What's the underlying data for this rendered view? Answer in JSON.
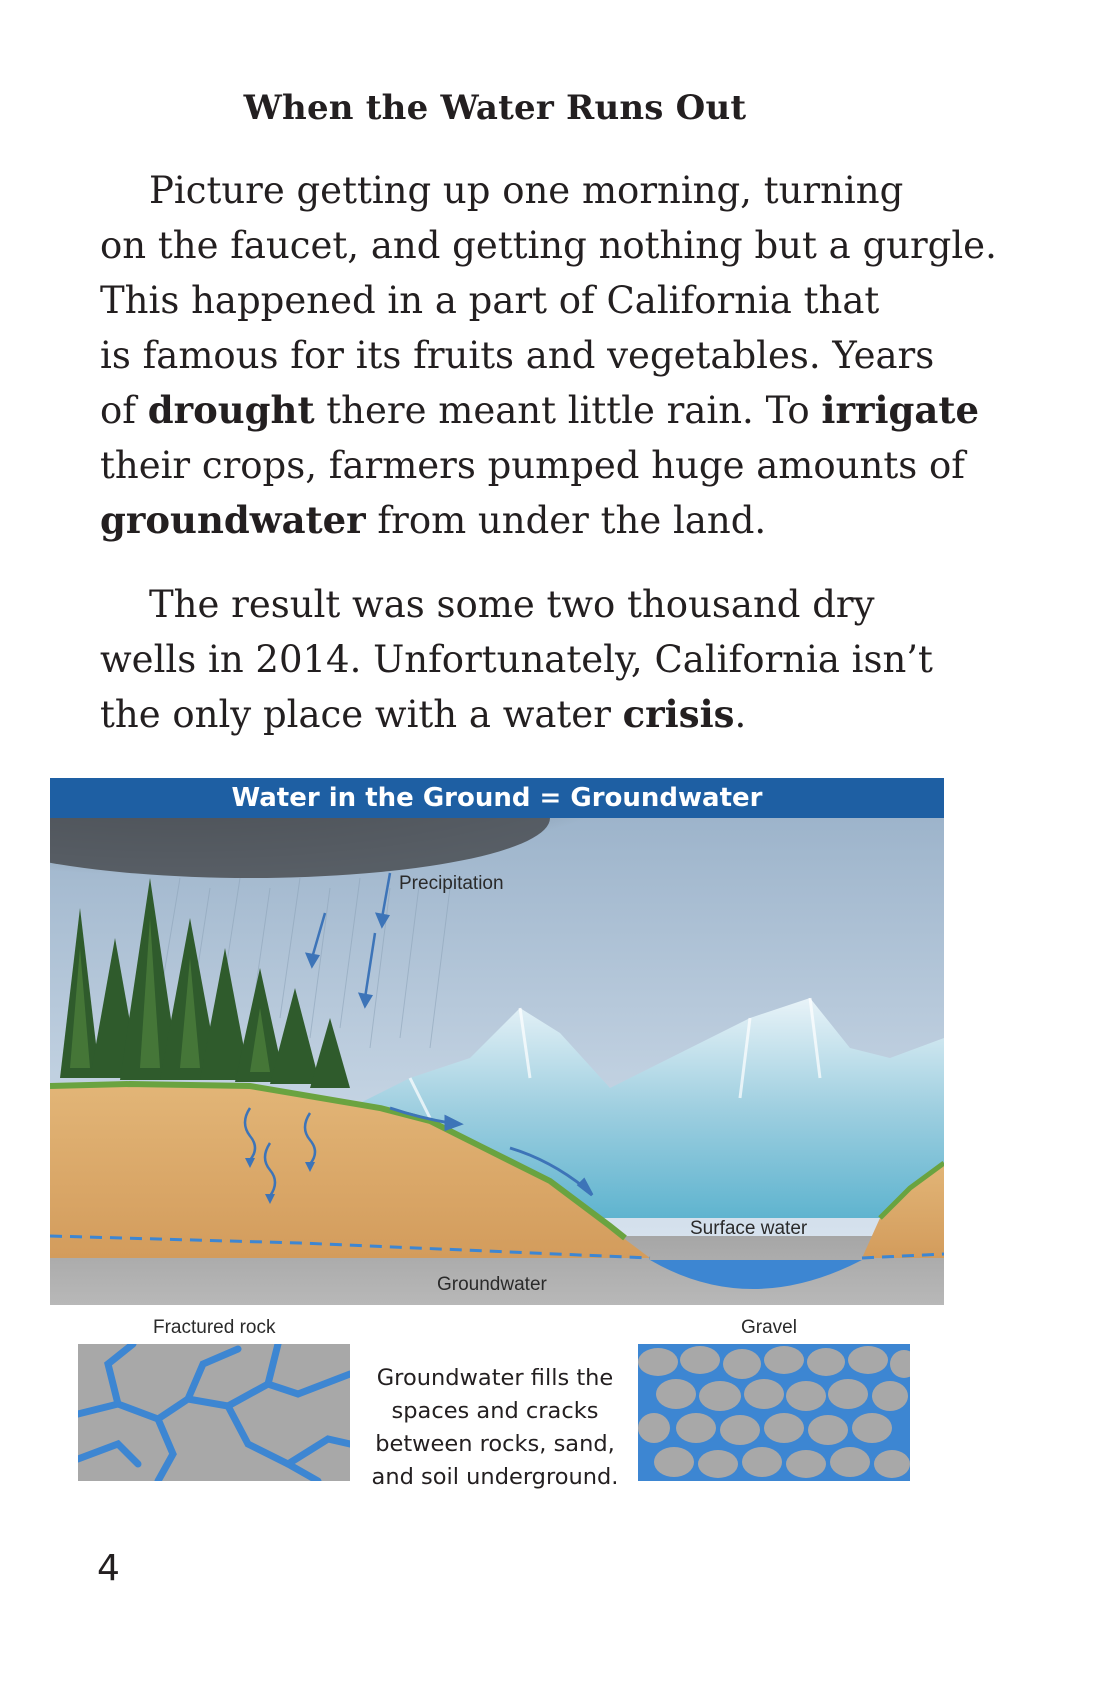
{
  "heading": "When the Water Runs Out",
  "paragraph1": {
    "line1": "Picture getting up one morning, turning",
    "line2": "on the faucet, and getting nothing but a gurgle.",
    "line3": "This happened in a part of California that",
    "line4": "is famous for its fruits and vegetables. Years",
    "line5_a": "of ",
    "line5_b": "drought",
    "line5_c": " there meant little rain. To ",
    "line5_d": "irrigate",
    "line6": "their crops, farmers pumped huge amounts of",
    "line7_a": "groundwater",
    "line7_b": " from under the land."
  },
  "paragraph2": {
    "line1": "The result was some two thousand dry",
    "line2": "wells in 2014. Unfortunately, California isn’t",
    "line3_a": "the only place with a water ",
    "line3_b": "crisis",
    "line3_c": "."
  },
  "figure": {
    "title": "Water in the Ground = Groundwater",
    "labels": {
      "precipitation": "Precipitation",
      "surface_water": "Surface water",
      "groundwater": "Groundwater"
    },
    "insets": {
      "fractured_rock": "Fractured rock",
      "gravel": "Gravel"
    },
    "caption": {
      "line1": "Groundwater fills the",
      "line2": "spaces and cracks",
      "line3": "between rocks, sand,",
      "line4": "and soil underground."
    },
    "colors": {
      "banner": "#1e5fa3",
      "water": "#3d86d2",
      "soil": "#d9a868",
      "rock": "#a9a9a9",
      "sky": "#c9dcee"
    }
  },
  "page_number": "4"
}
